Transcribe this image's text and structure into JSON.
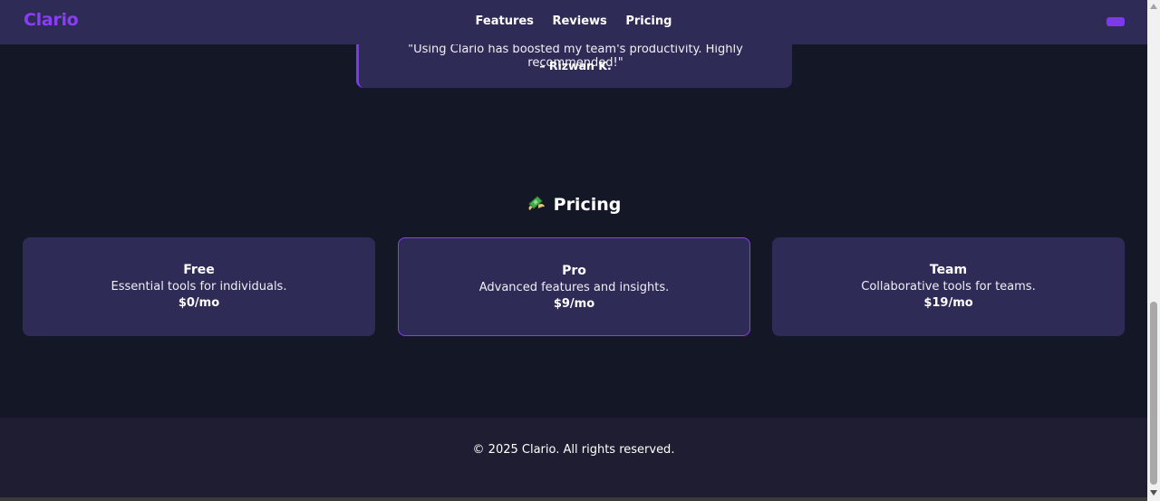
{
  "header": {
    "logo": "Clario",
    "nav": [
      "Features",
      "Reviews",
      "Pricing"
    ],
    "accent_color": "#8b3df5",
    "menu_icon": "menu-toggle-icon"
  },
  "testimonial": {
    "quote": "\"Using Clario has boosted my team's productivity. Highly recommended!\"",
    "author": "– Rizwan K."
  },
  "pricing": {
    "title_icon": "money-with-wings-icon",
    "title": "Pricing",
    "plans": [
      {
        "name": "Free",
        "description": "Essential tools for individuals.",
        "price": "$0/mo",
        "featured": false
      },
      {
        "name": "Pro",
        "description": "Advanced features and insights.",
        "price": "$9/mo",
        "featured": true
      },
      {
        "name": "Team",
        "description": "Collaborative tools for teams.",
        "price": "$19/mo",
        "featured": false
      }
    ]
  },
  "footer": {
    "copyright": "© 2025 Clario. All rights reserved."
  },
  "colors": {
    "background": "#141826",
    "card": "#2f2b57",
    "footer": "#1f1d31",
    "accent": "#7c3aed"
  }
}
